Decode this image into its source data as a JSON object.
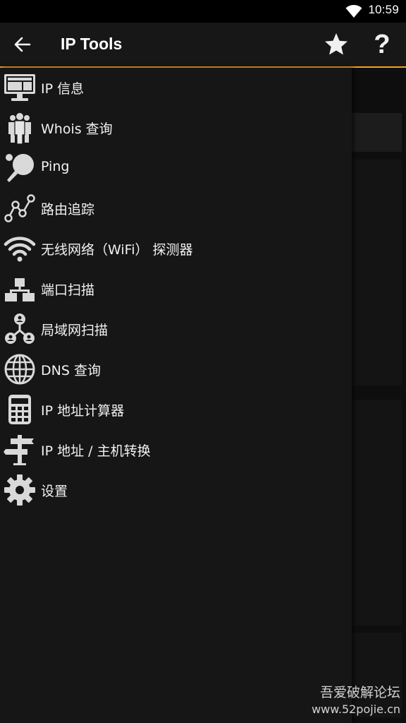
{
  "status_bar": {
    "time": "10:59",
    "wifi_icon": "wifi-icon"
  },
  "toolbar": {
    "back_icon": "back-arrow-icon",
    "title": "IP Tools",
    "favorite_icon": "star-icon",
    "help_label": "?"
  },
  "drawer": {
    "items": [
      {
        "label": "IP 信息",
        "icon": "monitor-icon"
      },
      {
        "label": "Whois 查询",
        "icon": "people-icon"
      },
      {
        "label": "Ping",
        "icon": "ping-pong-icon"
      },
      {
        "label": "路由追踪",
        "icon": "route-graph-icon"
      },
      {
        "label": "无线网络（WiFi） 探测器",
        "icon": "wifi-icon"
      },
      {
        "label": "端口扫描",
        "icon": "network-boxes-icon"
      },
      {
        "label": "局域网扫描",
        "icon": "user-network-icon"
      },
      {
        "label": "DNS 查询",
        "icon": "globe-icon"
      },
      {
        "label": "IP 地址计算器",
        "icon": "calculator-icon"
      },
      {
        "label": "IP 地址 / 主机转换",
        "icon": "signpost-icon"
      },
      {
        "label": "设置",
        "icon": "gear-icon"
      }
    ]
  },
  "watermark": {
    "name": "吾爱破解论坛",
    "url": "www.52pojie.cn"
  },
  "colors": {
    "accent": "#f5a21b",
    "toolbar_bg": "#171717",
    "drawer_bg": "#161616",
    "icon_color": "#d9d9d9"
  }
}
